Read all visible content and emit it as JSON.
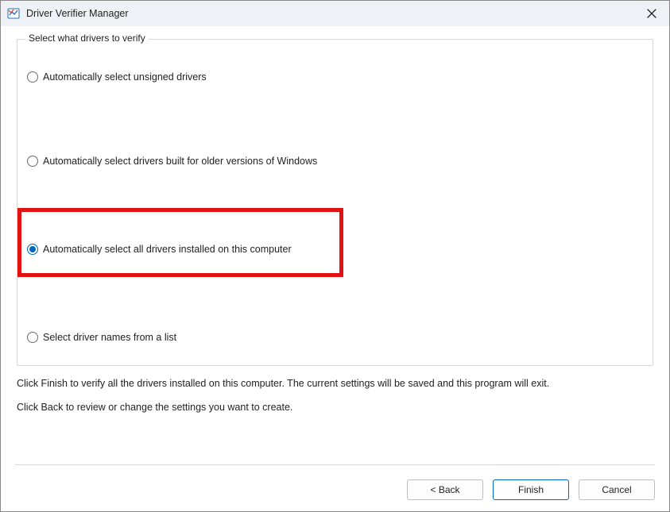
{
  "window": {
    "title": "Driver Verifier Manager"
  },
  "fieldset": {
    "legend": "Select what drivers to verify",
    "options": [
      {
        "label": "Automatically select unsigned drivers",
        "selected": false
      },
      {
        "label": "Automatically select drivers built for older versions of Windows",
        "selected": false
      },
      {
        "label": "Automatically select all drivers installed on this computer",
        "selected": true
      },
      {
        "label": "Select driver names from a list",
        "selected": false
      }
    ]
  },
  "instructions": {
    "line1": "Click Finish to verify all the drivers installed on this computer. The current settings will be saved and this program will exit.",
    "line2": "Click Back to review or change the settings you want to create."
  },
  "buttons": {
    "back": "< Back",
    "finish": "Finish",
    "cancel": "Cancel"
  }
}
